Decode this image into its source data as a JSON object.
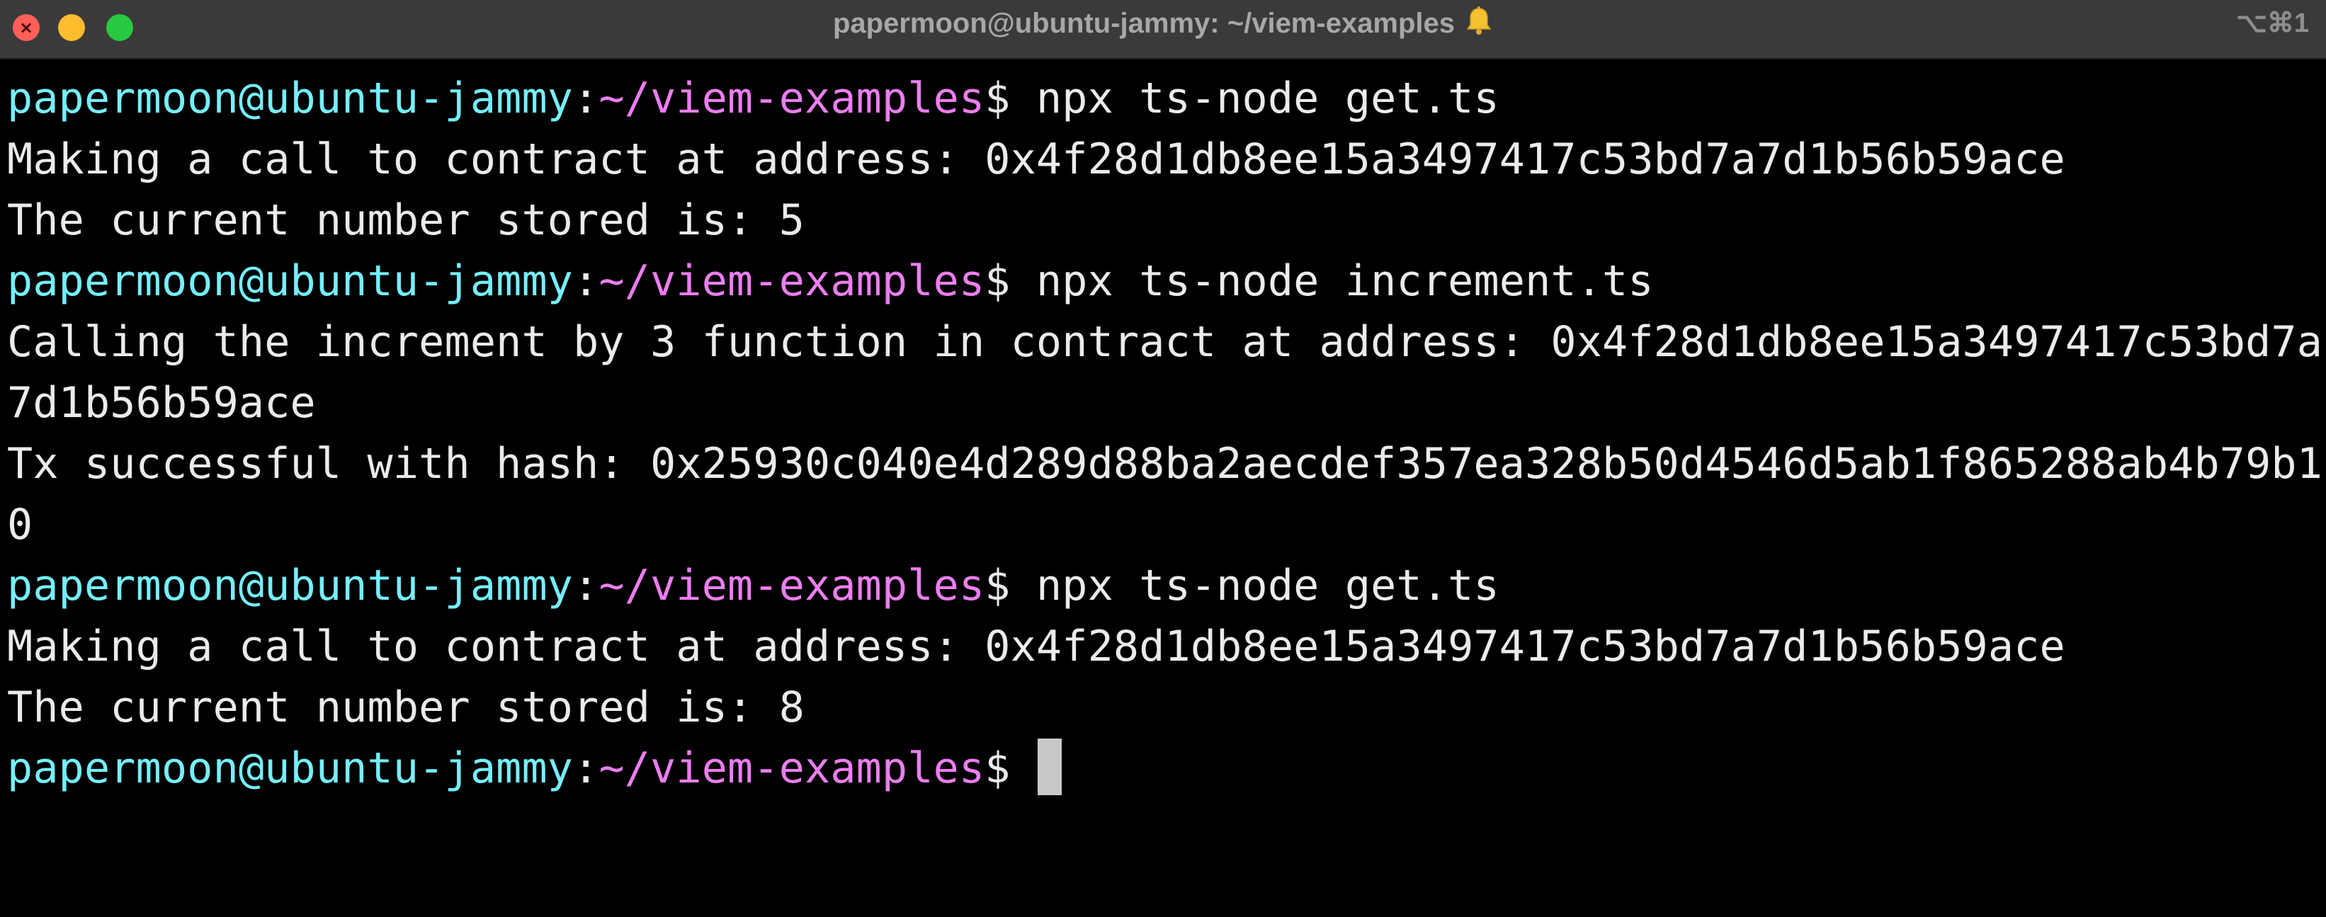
{
  "window": {
    "title": "papermoon@ubuntu-jammy: ~/viem-examples",
    "title_icon": "bell-icon",
    "shortcut": "⌥⌘1",
    "buttons": {
      "close": "close-button",
      "minimize": "minimize-button",
      "maximize": "maximize-button"
    },
    "colors": {
      "titlebar": "#3a3a3a",
      "background": "#000000",
      "user_host": "#75f0fd",
      "path": "#ec7ef0",
      "text": "#ecebeb"
    }
  },
  "terminal": {
    "prompt": {
      "user_host": "papermoon@ubuntu-jammy",
      "colon": ":",
      "path": "~/viem-examples",
      "symbol": "$"
    },
    "lines": [
      {
        "type": "prompt",
        "command": " npx ts-node get.ts"
      },
      {
        "type": "output",
        "text": "Making a call to contract at address: 0x4f28d1db8ee15a3497417c53bd7a7d1b56b59ace"
      },
      {
        "type": "output",
        "text": "The current number stored is: 5"
      },
      {
        "type": "prompt",
        "command": " npx ts-node increment.ts"
      },
      {
        "type": "output",
        "text": "Calling the increment by 3 function in contract at address: 0x4f28d1db8ee15a3497417c53bd7a"
      },
      {
        "type": "output",
        "text": "7d1b56b59ace"
      },
      {
        "type": "output",
        "text": "Tx successful with hash: 0x25930c040e4d289d88ba2aecdef357ea328b50d4546d5ab1f865288ab4b79b1"
      },
      {
        "type": "output",
        "text": "0"
      },
      {
        "type": "prompt",
        "command": " npx ts-node get.ts"
      },
      {
        "type": "output",
        "text": "Making a call to contract at address: 0x4f28d1db8ee15a3497417c53bd7a7d1b56b59ace"
      },
      {
        "type": "output",
        "text": "The current number stored is: 8"
      },
      {
        "type": "prompt",
        "command": " "
      }
    ]
  }
}
